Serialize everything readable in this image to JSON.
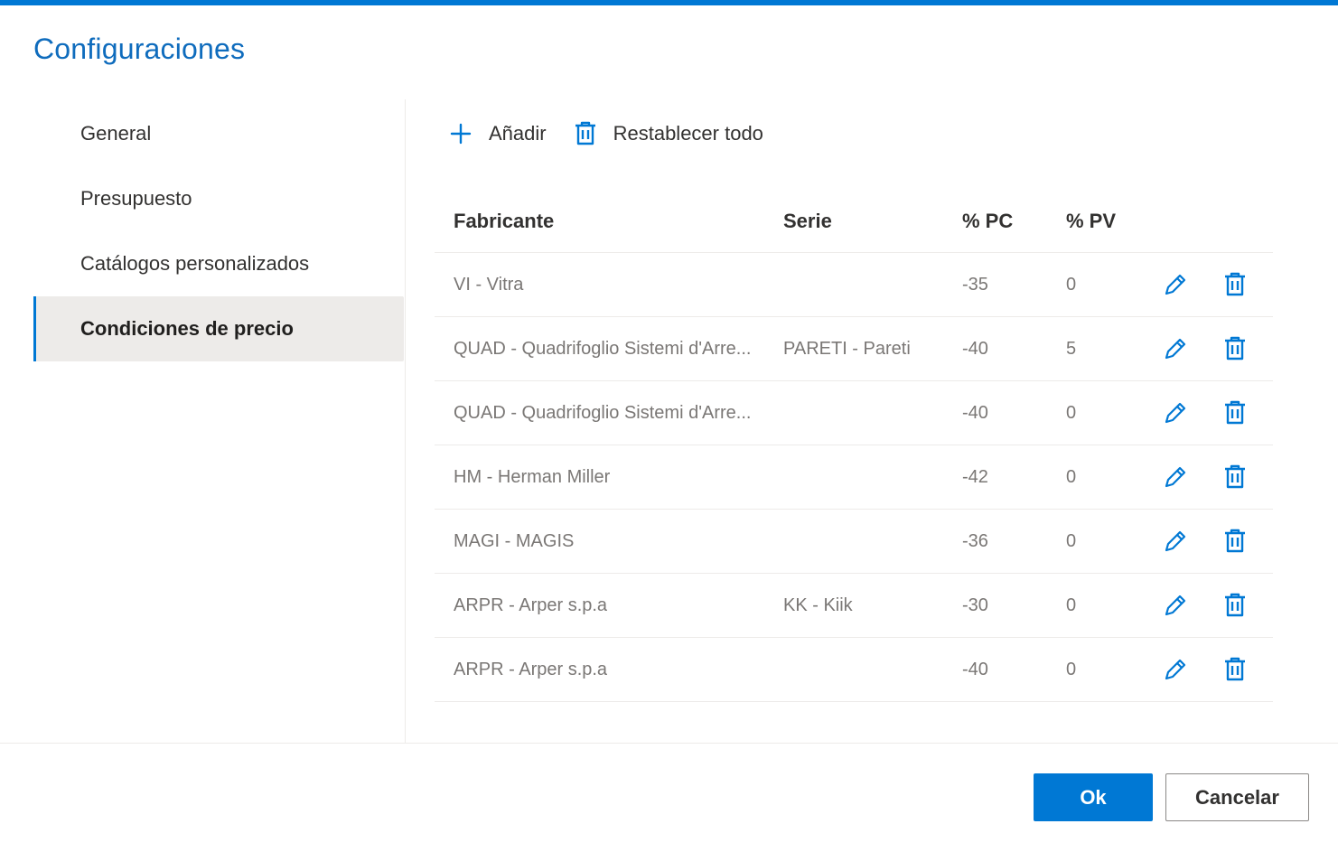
{
  "dialog": {
    "title": "Configuraciones"
  },
  "sidebar": {
    "items": [
      {
        "label": "General",
        "active": false
      },
      {
        "label": "Presupuesto",
        "active": false
      },
      {
        "label": "Catálogos personalizados",
        "active": false
      },
      {
        "label": "Condiciones de precio",
        "active": true
      }
    ]
  },
  "toolbar": {
    "add_label": "Añadir",
    "add_icon": "plus-icon",
    "reset_label": "Restablecer todo",
    "reset_icon": "trash-icon"
  },
  "table": {
    "headers": [
      "Fabricante",
      "Serie",
      "% PC",
      "% PV"
    ],
    "rows": [
      {
        "fabricante": "VI - Vitra",
        "serie": "",
        "pc": "-35",
        "pv": "0"
      },
      {
        "fabricante": "QUAD - Quadrifoglio Sistemi d'Arre...",
        "serie": "PARETI - Pareti",
        "pc": "-40",
        "pv": "5"
      },
      {
        "fabricante": "QUAD - Quadrifoglio Sistemi d'Arre...",
        "serie": "",
        "pc": "-40",
        "pv": "0"
      },
      {
        "fabricante": "HM - Herman Miller",
        "serie": "",
        "pc": "-42",
        "pv": "0"
      },
      {
        "fabricante": "MAGI - MAGIS",
        "serie": "",
        "pc": "-36",
        "pv": "0"
      },
      {
        "fabricante": "ARPR - Arper s.p.a",
        "serie": "KK - Kiik",
        "pc": "-30",
        "pv": "0"
      },
      {
        "fabricante": "ARPR - Arper s.p.a",
        "serie": "",
        "pc": "-40",
        "pv": "0"
      }
    ],
    "row_actions": [
      "pencil-icon",
      "trash-icon"
    ]
  },
  "footer": {
    "ok_label": "Ok",
    "cancel_label": "Cancelar"
  },
  "colors": {
    "accent": "#0078d4",
    "active_nav_bg": "#edebe9",
    "muted_text": "#7a7775"
  }
}
